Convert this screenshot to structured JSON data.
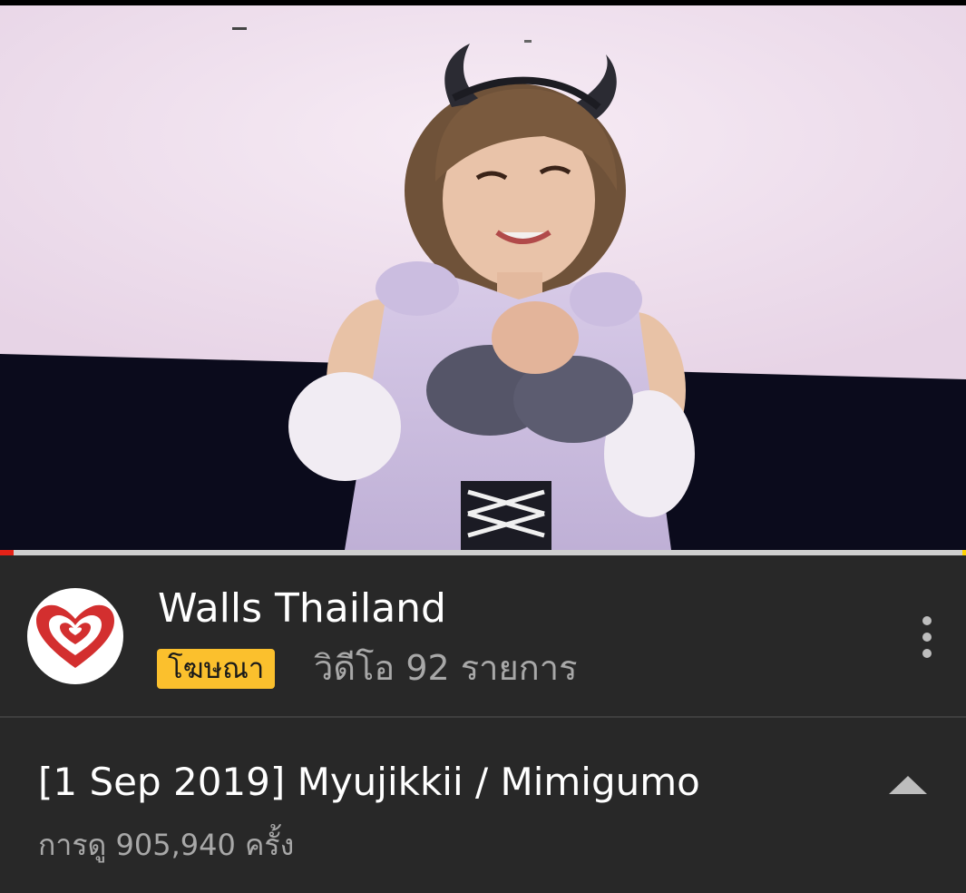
{
  "player": {
    "progress_fraction": 0.014,
    "colors": {
      "played": "#e52217",
      "track": "#cfcfcf"
    }
  },
  "channel": {
    "name": "Walls Thailand",
    "ad_badge": "โฆษณา",
    "video_count": "วิดีโอ 92 รายการ",
    "avatar_icon": "walls-heart-logo",
    "more_icon": "more-vert-icon"
  },
  "video": {
    "title": "[1 Sep 2019] Myujikkii / Mimigumo",
    "views": "การดู 905,940 ครั้ง",
    "collapse_icon": "caret-up-icon"
  },
  "colors": {
    "background": "#282828",
    "badge": "#fbc02d",
    "secondary_text": "#a8a8a8"
  }
}
